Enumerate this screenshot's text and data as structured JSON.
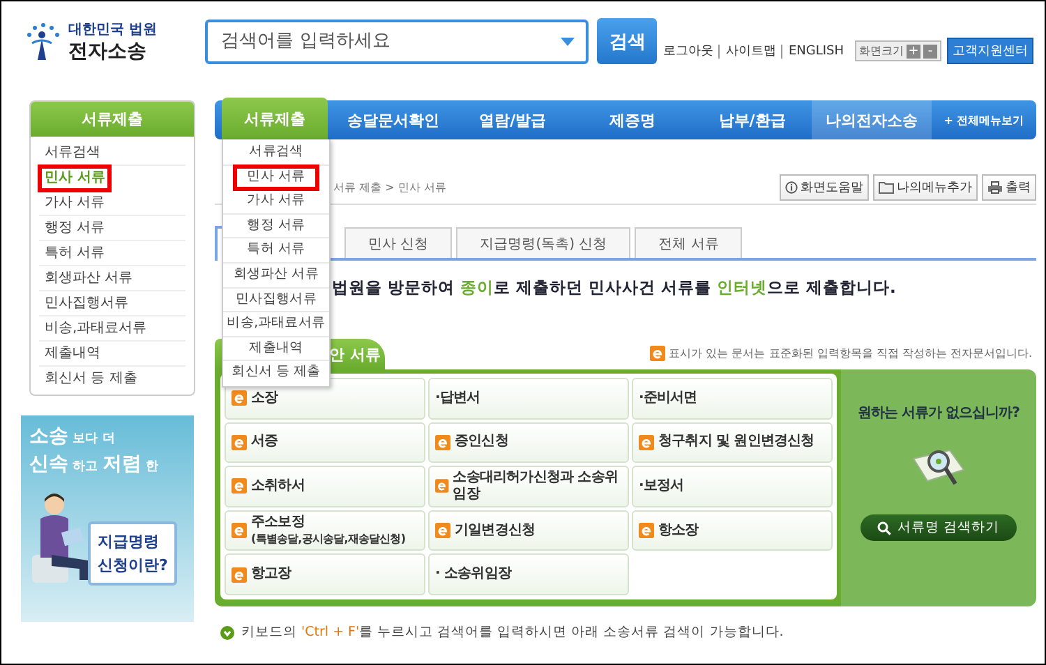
{
  "header": {
    "logo": {
      "org": "대한민국 법원",
      "name": "전자소송"
    },
    "search": {
      "placeholder": "검색어를 입력하세요",
      "button": "검색"
    },
    "links": [
      "로그아웃",
      "사이트맵",
      "ENGLISH"
    ],
    "zoom": {
      "label": "화면크기",
      "buttons": [
        "+",
        "-"
      ]
    },
    "support": "고객지원센터"
  },
  "sidebar": {
    "title": "서류제출",
    "items": [
      {
        "label": "서류검색",
        "selected": false
      },
      {
        "label": "민사 서류",
        "selected": true
      },
      {
        "label": "가사 서류",
        "selected": false
      },
      {
        "label": "행정 서류",
        "selected": false
      },
      {
        "label": "특허 서류",
        "selected": false
      },
      {
        "label": "회생파산 서류",
        "selected": false
      },
      {
        "label": "민사집행서류",
        "selected": false
      },
      {
        "label": "비송,과태료서류",
        "selected": false
      },
      {
        "label": "제출내역",
        "selected": false
      },
      {
        "label": "회신서 등 제출",
        "selected": false
      }
    ]
  },
  "banner": {
    "headline": [
      "**소송** 보다 더",
      "**신속** 하고 **저렴** 한"
    ],
    "callout": [
      "지급명령",
      "신청이란?"
    ]
  },
  "nav": {
    "items": [
      {
        "label": "서류제출",
        "selected": true,
        "highlighted": false
      },
      {
        "label": "송달문서확인",
        "selected": false,
        "highlighted": false
      },
      {
        "label": "열람/발급",
        "selected": false,
        "highlighted": false
      },
      {
        "label": "제증명",
        "selected": false,
        "highlighted": false
      },
      {
        "label": "납부/환급",
        "selected": false,
        "highlighted": false
      },
      {
        "label": "나의전자소송",
        "selected": false,
        "highlighted": true
      }
    ],
    "all_menu": "+ 전체메뉴보기"
  },
  "dropdown": {
    "items": [
      {
        "label": "서류검색",
        "selected": false
      },
      {
        "label": "민사 서류",
        "selected": true
      },
      {
        "label": "가사 서류",
        "selected": false
      },
      {
        "label": "행정 서류",
        "selected": false
      },
      {
        "label": "특허 서류",
        "selected": false
      },
      {
        "label": "회생파산 서류",
        "selected": false
      },
      {
        "label": "민사집행서류",
        "selected": false
      },
      {
        "label": "비송,과태료서류",
        "selected": false
      },
      {
        "label": "제출내역",
        "selected": false
      },
      {
        "label": "회신서 등 제출",
        "selected": false
      }
    ]
  },
  "breadcrumb": "서류 제출 > 민사 서류",
  "tools": [
    {
      "kind": "help",
      "label": "화면도움말"
    },
    {
      "kind": "bookmark",
      "label": "나의메뉴추가"
    },
    {
      "kind": "print",
      "label": "출력"
    }
  ],
  "tabs": [
    {
      "selected": true
    },
    {
      "label": "민사 신청",
      "selected": false
    },
    {
      "label": "지급명령(독촉) 신청",
      "selected": false
    },
    {
      "label": "전체 서류",
      "selected": false
    }
  ],
  "intro": [
    {
      "text": "법원을 방문하여 ",
      "highlight": false
    },
    {
      "text": "종이",
      "highlight": true
    },
    {
      "text": "로 제출하던 민사사건 서류를 ",
      "highlight": false
    },
    {
      "text": "인터넷",
      "highlight": true
    },
    {
      "text": "으로 제출합니다.",
      "highlight": false
    }
  ],
  "documents": {
    "title": "안 서류",
    "note": "표시가 있는 문서는 표준화된 입력항목을 직접 작성하는 전자문서입니다.",
    "items": [
      {
        "kind": "e-form",
        "label": "소장"
      },
      {
        "kind": "plain",
        "label": "·답변서"
      },
      {
        "kind": "plain",
        "label": "·준비서면"
      },
      {
        "kind": "e-form",
        "label": "서증"
      },
      {
        "kind": "e-form",
        "label": "증인신청"
      },
      {
        "kind": "e-form",
        "label": "청구취지 및 원인변경신청"
      },
      {
        "kind": "e-form",
        "label": "소취하서"
      },
      {
        "kind": "e-form",
        "label": "소송대리허가신청과 소송위임장"
      },
      {
        "kind": "plain",
        "label": "·보정서"
      },
      {
        "kind": "e-form",
        "label": "주소보정",
        "sub": "(특별송달,공시송달,재송달신청)"
      },
      {
        "kind": "e-form",
        "label": "기일변경신청"
      },
      {
        "kind": "e-form",
        "label": "항소장"
      },
      {
        "kind": "e-form",
        "label": "항고장"
      },
      {
        "kind": "plain",
        "label": "· 소송위임장"
      }
    ]
  },
  "finder": {
    "question": "원하는 서류가 없으십니까?",
    "button": "서류명 검색하기"
  },
  "footer_note": [
    {
      "text": "키보드의 ",
      "highlight": false
    },
    {
      "text": "'Ctrl + F'",
      "highlight": true
    },
    {
      "text": "를 누르시고 검색어를 입력하시면 아래 소송서류 검색이 가능합니다.",
      "highlight": false
    }
  ]
}
